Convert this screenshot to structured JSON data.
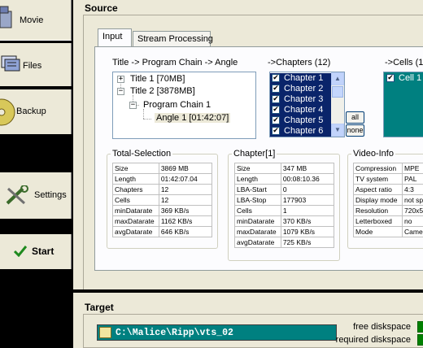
{
  "nav": {
    "movie": "Movie",
    "files": "Files",
    "backup": "Backup",
    "settings": "Settings",
    "start": "Start"
  },
  "source": {
    "title": "Source",
    "tabs": [
      "Input",
      "Stream Processing"
    ],
    "tree_label": "Title -> Program Chain -> Angle",
    "tree": {
      "title1": "Title 1 [70MB]",
      "title2": "Title 2 [3878MB]",
      "pgc": "Program Chain 1",
      "angle": "Angle 1 [01:42:07]"
    },
    "chapters_label": "->Chapters (12)",
    "chapters": [
      "Chapter 1",
      "Chapter 2",
      "Chapter 3",
      "Chapter 4",
      "Chapter 5",
      "Chapter 6"
    ],
    "all_button": "all",
    "none_button": "none",
    "cells_label": "->Cells (1",
    "cells": [
      "Cell 1"
    ],
    "total_selection": {
      "title": "Total-Selection",
      "rows": [
        [
          "Size",
          "3869 MB"
        ],
        [
          "Length",
          "01:42:07.04"
        ],
        [
          "Chapters",
          "12"
        ],
        [
          "Cells",
          "12"
        ],
        [
          "minDatarate",
          "369 KB/s"
        ],
        [
          "maxDatarate",
          "1162 KB/s"
        ],
        [
          "avgDatarate",
          "646 KB/s"
        ]
      ]
    },
    "chapter_info": {
      "title": "Chapter[1]",
      "rows": [
        [
          "Size",
          "347 MB"
        ],
        [
          "Length",
          "00:08:10.36"
        ],
        [
          "LBA-Start",
          "0"
        ],
        [
          "LBA-Stop",
          "177903"
        ],
        [
          "Cells",
          "1"
        ],
        [
          "minDatarate",
          "370 KB/s"
        ],
        [
          "maxDatarate",
          "1079 KB/s"
        ],
        [
          "avgDatarate",
          "725 KB/s"
        ]
      ]
    },
    "video_info": {
      "title": "Video-Info",
      "rows": [
        [
          "Compression",
          "MPE"
        ],
        [
          "TV system",
          "PAL"
        ],
        [
          "Aspect ratio",
          "4:3"
        ],
        [
          "Display mode",
          "not sp"
        ],
        [
          "Resolution",
          "720x5"
        ],
        [
          "Letterboxed",
          "no"
        ],
        [
          "Mode",
          "Came"
        ]
      ]
    }
  },
  "target": {
    "title": "Target",
    "path": "C:\\Malice\\Ripp\\vts_02",
    "free_label": "free diskspace",
    "required_label": "required diskspace"
  },
  "colors": {
    "selection": "#0a246a",
    "teal": "#008080",
    "disk_green": "#008000"
  }
}
